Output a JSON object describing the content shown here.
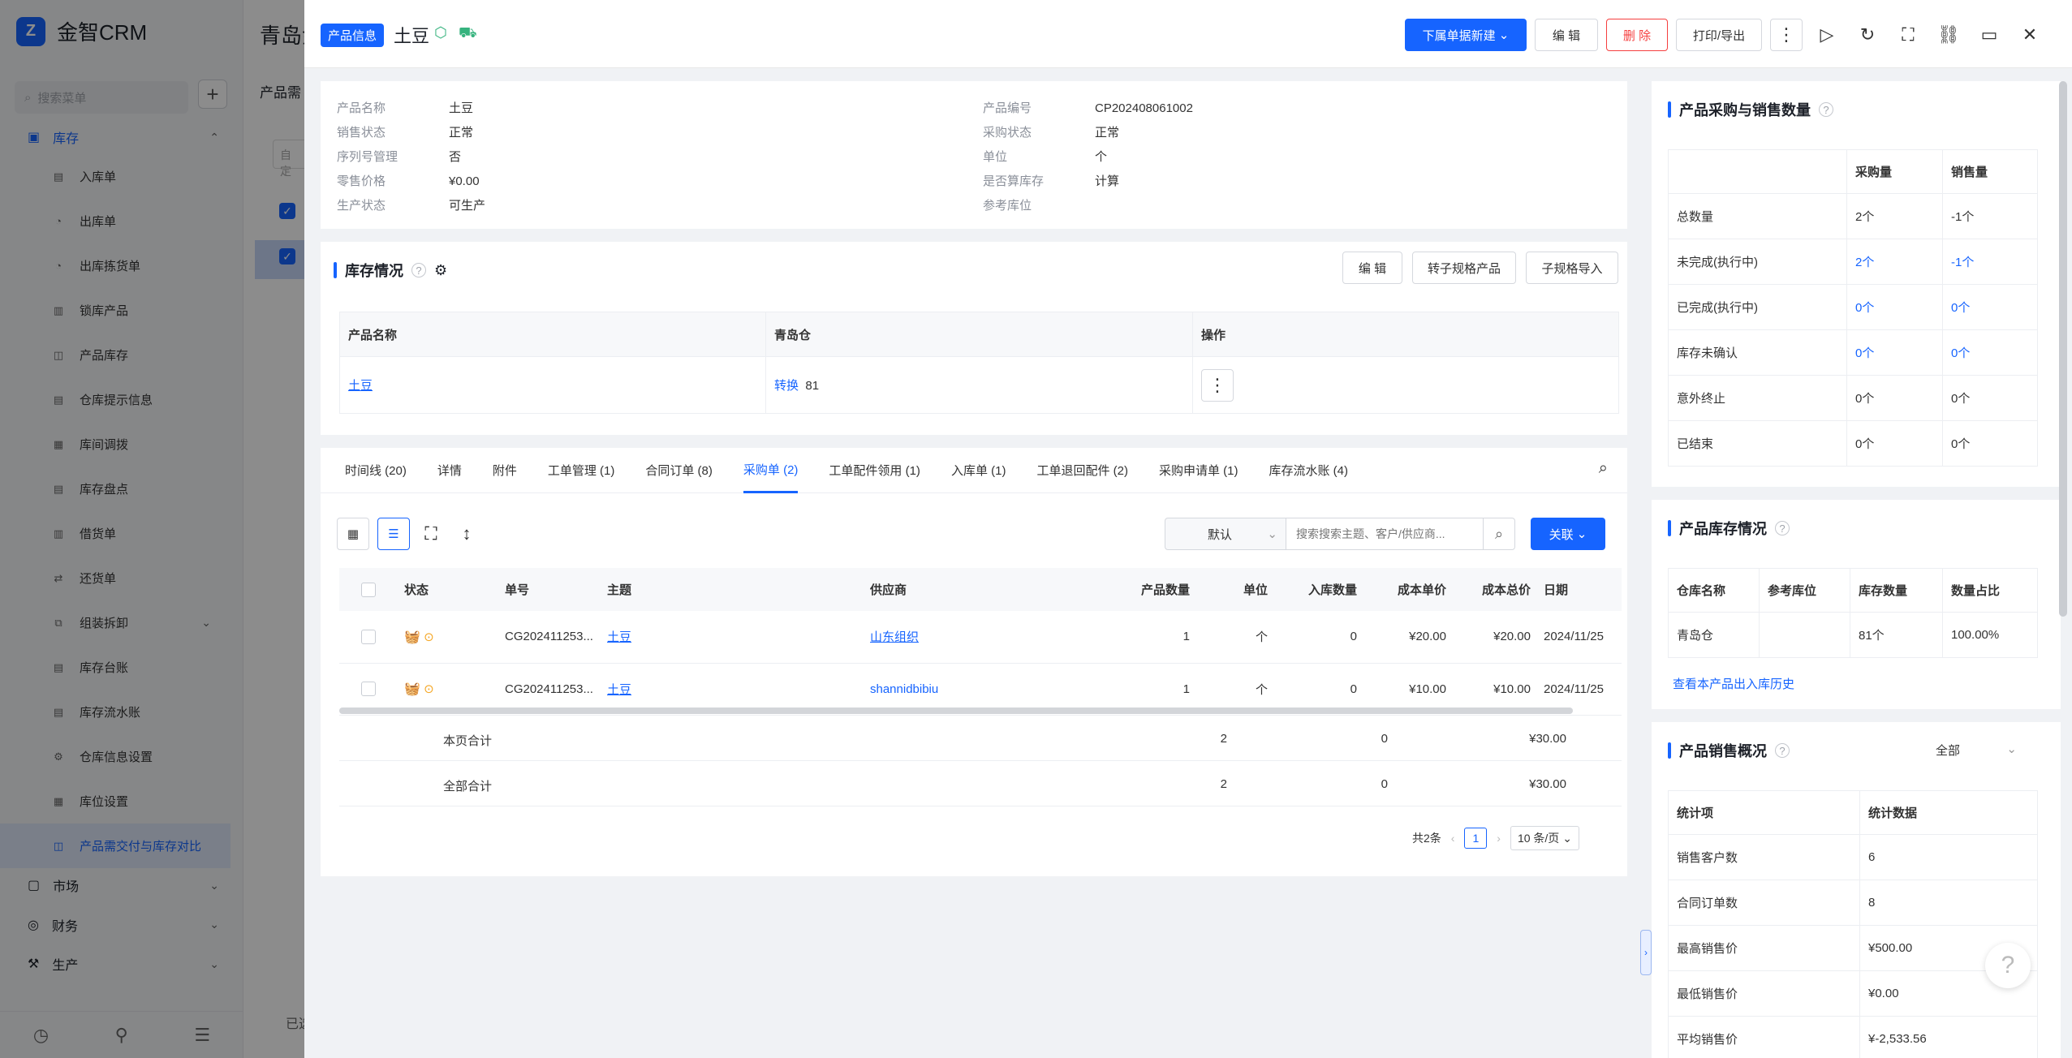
{
  "app": {
    "brand": "金智CRM",
    "search_placeholder": "搜索菜单",
    "bg_title": "青岛金",
    "bg_tab": "产品需",
    "bg_filter": "自定",
    "bg_status": "已选",
    "nav": {
      "inventory": "库存",
      "items": [
        "入库单",
        "出库单",
        "出库拣货单",
        "锁库产品",
        "产品库存",
        "仓库提示信息",
        "库间调拨",
        "库存盘点",
        "借货单",
        "还货单",
        "组装拆卸",
        "库存台账",
        "库存流水账",
        "仓库信息设置",
        "库位设置",
        "产品需交付与库存对比"
      ],
      "market": "市场",
      "finance": "财务",
      "production": "生产"
    }
  },
  "drawer": {
    "tag": "产品信息",
    "title": "土豆",
    "buttons": {
      "create_downstream": "下属单据新建",
      "edit": "编 辑",
      "delete": "删 除",
      "print_export": "打印/导出"
    },
    "info_left": [
      {
        "k": "产品名称",
        "v": "土豆"
      },
      {
        "k": "销售状态",
        "v": "正常"
      },
      {
        "k": "序列号管理",
        "v": "否"
      },
      {
        "k": "零售价格",
        "v": "¥0.00"
      },
      {
        "k": "生产状态",
        "v": "可生产"
      }
    ],
    "info_right": [
      {
        "k": "产品编号",
        "v": "CP202408061002"
      },
      {
        "k": "采购状态",
        "v": "正常"
      },
      {
        "k": "单位",
        "v": "个"
      },
      {
        "k": "是否算库存",
        "v": "计算"
      },
      {
        "k": "参考库位",
        "v": ""
      }
    ],
    "inventory": {
      "title": "库存情况",
      "edit": "编 辑",
      "transfer": "转子规格产品",
      "import": "子规格导入",
      "headers": [
        "产品名称",
        "青岛仓",
        "操作"
      ],
      "row": {
        "name": "土豆",
        "convert": "转换",
        "qty": "81"
      }
    },
    "tabs": [
      "时间线 (20)",
      "详情",
      "附件",
      "工单管理 (1)",
      "合同订单 (8)",
      "采购单 (2)",
      "工单配件领用 (1)",
      "入库单 (1)",
      "工单退回配件 (2)",
      "采购申请单 (1)",
      "库存流水账 (4)"
    ],
    "toolbar": {
      "default": "默认",
      "search_placeholder": "搜索搜索主题、客户/供应商...",
      "link": "关联"
    },
    "po_table": {
      "headers": [
        "状态",
        "单号",
        "主题",
        "供应商",
        "产品数量",
        "单位",
        "入库数量",
        "成本单价",
        "成本总价",
        "日期"
      ],
      "rows": [
        {
          "no": "CG202411253...",
          "subject": "土豆",
          "supplier": "山东组织",
          "qty": "1",
          "unit": "个",
          "in_qty": "0",
          "unit_cost": "¥20.00",
          "total": "¥20.00",
          "date": "2024/11/25"
        },
        {
          "no": "CG202411253...",
          "subject": "土豆",
          "supplier": "shannidbibiu",
          "qty": "1",
          "unit": "个",
          "in_qty": "0",
          "unit_cost": "¥10.00",
          "total": "¥10.00",
          "date": "2024/11/25"
        }
      ],
      "page_total": {
        "label": "本页合计",
        "qty": "2",
        "in_qty": "0",
        "total": "¥30.00"
      },
      "all_total": {
        "label": "全部合计",
        "qty": "2",
        "in_qty": "0",
        "total": "¥30.00"
      }
    },
    "pagination": {
      "total": "共2条",
      "page": "1",
      "size": "10 条/页"
    },
    "purchase_sales": {
      "title": "产品采购与销售数量",
      "headers": [
        "",
        "采购量",
        "销售量"
      ],
      "rows": [
        {
          "k": "总数量",
          "a": "2个",
          "b": "-1个"
        },
        {
          "k": "未完成(执行中)",
          "a": "2个",
          "b": "-1个"
        },
        {
          "k": "已完成(执行中)",
          "a": "0个",
          "b": "0个"
        },
        {
          "k": "库存未确认",
          "a": "0个",
          "b": "0个"
        },
        {
          "k": "意外终止",
          "a": "0个",
          "b": "0个"
        },
        {
          "k": "已结束",
          "a": "0个",
          "b": "0个"
        }
      ]
    },
    "stock": {
      "title": "产品库存情况",
      "headers": [
        "仓库名称",
        "参考库位",
        "库存数量",
        "数量占比"
      ],
      "row": [
        "青岛仓",
        "",
        "81个",
        "100.00%"
      ],
      "history_link": "查看本产品出入库历史"
    },
    "sales": {
      "title": "产品销售概况",
      "filter": "全部",
      "headers": [
        "统计项",
        "统计数据"
      ],
      "rows": [
        {
          "k": "销售客户数",
          "v": "6"
        },
        {
          "k": "合同订单数",
          "v": "8"
        },
        {
          "k": "最高销售价",
          "v": "¥500.00"
        },
        {
          "k": "最低销售价",
          "v": "¥0.00"
        },
        {
          "k": "平均销售价",
          "v": "¥-2,533.56"
        }
      ]
    }
  }
}
